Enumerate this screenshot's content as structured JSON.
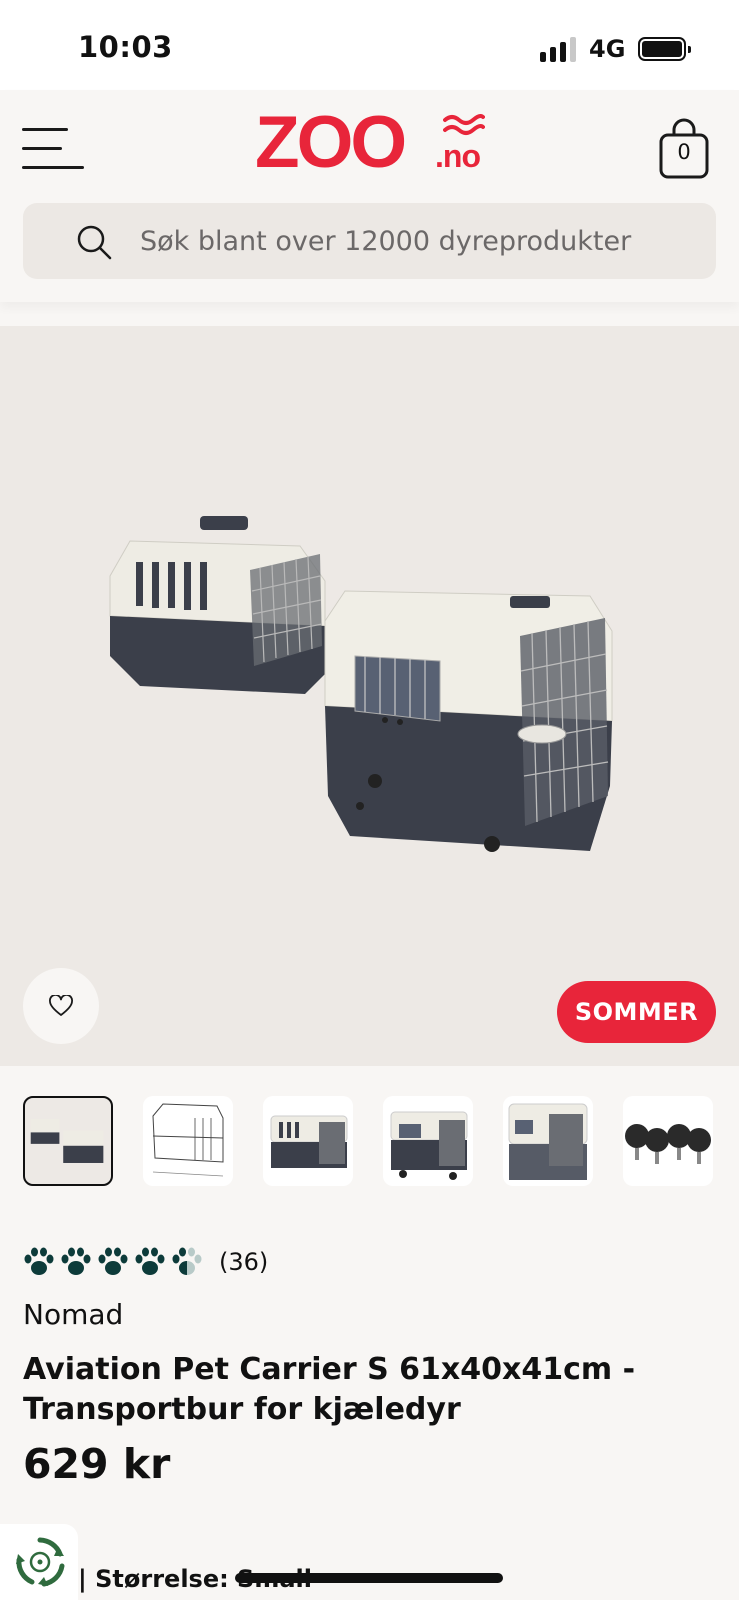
{
  "status_bar": {
    "time": "10:03",
    "network": "4G",
    "signal_bars": 3,
    "battery_level": 0.95
  },
  "header": {
    "menu_icon": "hamburger-menu-icon",
    "logo": {
      "main": "ZOO",
      "suffix": ".no"
    },
    "cart": {
      "count": "0",
      "icon": "shopping-bag-icon"
    },
    "search": {
      "placeholder": "Søk blant over 12000 dyreprodukter",
      "icon": "search-icon"
    }
  },
  "hero": {
    "favorite_icon": "heart-icon",
    "promo_badge": "SOMMER"
  },
  "thumbnails": [
    {
      "alt": "two carriers",
      "active": true
    },
    {
      "alt": "dimension drawing",
      "active": false
    },
    {
      "alt": "carrier side view",
      "active": false
    },
    {
      "alt": "carrier with wheels",
      "active": false
    },
    {
      "alt": "carrier front door",
      "active": false
    },
    {
      "alt": "wheels",
      "active": false
    }
  ],
  "product": {
    "rating": {
      "value": 4.5,
      "max": 5,
      "count_label": "(36)",
      "icon": "paw-icon"
    },
    "brand": "Nomad",
    "title_line1": "Aviation Pet Carrier S 61x40x41cm -",
    "title_line2": "Transportbur for kjæledyr",
    "price": "629 kr",
    "size_label": "| Størrelse: Small"
  },
  "colors": {
    "brand_red": "#e8253a",
    "paw_green": "#0d3b3a",
    "background": "#f8f6f4",
    "hero_bg": "#ede9e5"
  }
}
